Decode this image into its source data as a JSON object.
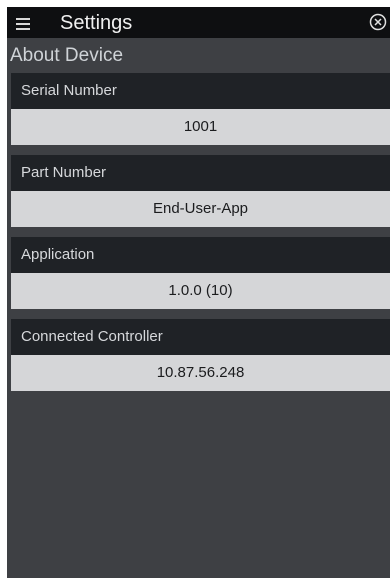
{
  "header": {
    "title": "Settings",
    "menu_icon": "hamburger-menu-icon",
    "close_icon": "close-circle-icon"
  },
  "section": {
    "title": "About Device"
  },
  "fields": [
    {
      "label": "Serial Number",
      "value": "1001"
    },
    {
      "label": "Part Number",
      "value": "End-User-App"
    },
    {
      "label": "Application",
      "value": "1.0.0 (10)"
    },
    {
      "label": "Connected Controller",
      "value": "10.87.56.248"
    }
  ],
  "colors": {
    "background": "#3e4044",
    "topbar": "#0e0f11",
    "card_header": "#1f2226",
    "card_value": "#d5d6d8"
  }
}
